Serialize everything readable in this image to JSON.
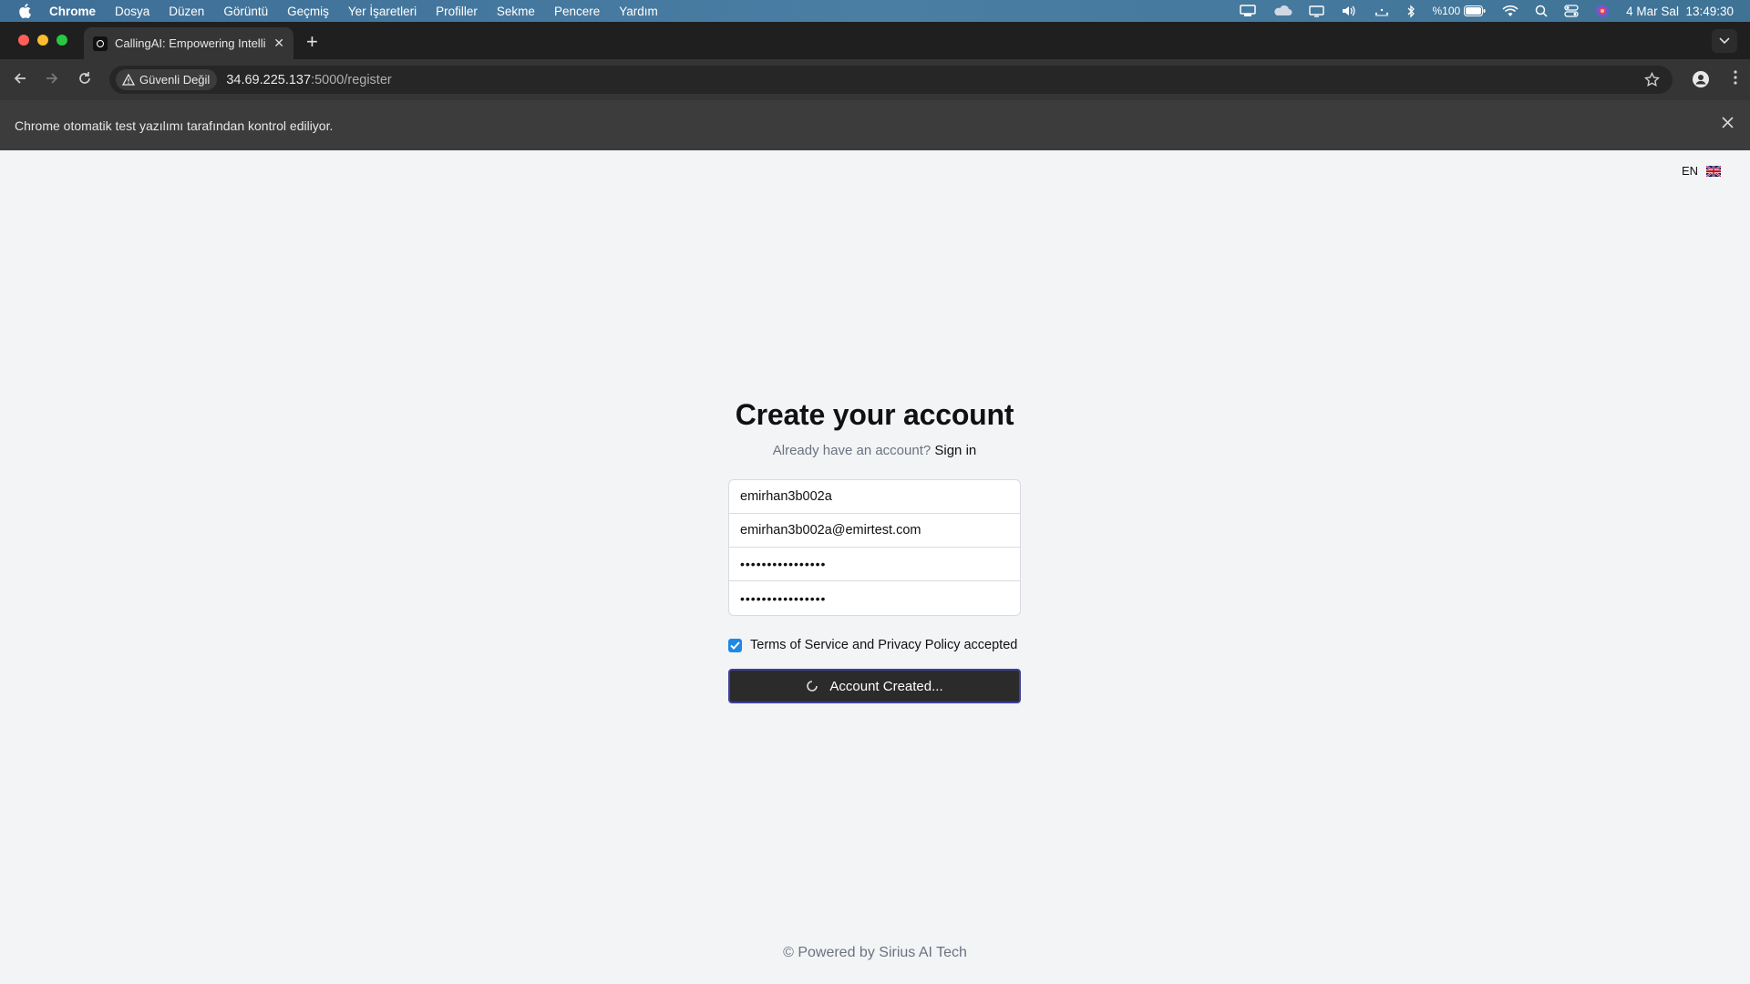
{
  "menubar": {
    "app": "Chrome",
    "items": [
      "Dosya",
      "Düzen",
      "Görüntü",
      "Geçmiş",
      "Yer İşaretleri",
      "Profiller",
      "Sekme",
      "Pencere",
      "Yardım"
    ],
    "battery": "%100",
    "datetime": "4 Mar Sal  13:49:30",
    "status_icons": [
      "screen-mirror-icon",
      "cloud-icon",
      "display-icon",
      "volume-icon",
      "dots-icon",
      "bluetooth-icon",
      "battery-icon",
      "wifi-icon",
      "search-icon",
      "control-center-icon",
      "siri-icon"
    ]
  },
  "browser": {
    "tab_title": "CallingAI: Empowering Intellig",
    "security_label": "Güvenli Değil",
    "url_host": "34.69.225.137",
    "url_path": ":5000/register",
    "infobar_text": "Chrome otomatik test yazılımı tarafından kontrol ediliyor."
  },
  "page": {
    "lang_code": "EN",
    "title": "Create your account",
    "subtitle_prefix": "Already have an account?",
    "signin_link": "Sign in",
    "fields": {
      "username": "emirhan3b002a",
      "email": "emirhan3b002a@emirtest.com",
      "password": "••••••••••••••••",
      "confirm_password": "••••••••••••••••"
    },
    "terms_label": "Terms of Service and Privacy Policy accepted",
    "terms_checked": true,
    "submit_label": "Account Created...",
    "footer": "© Powered by Sirius AI Tech"
  },
  "colors": {
    "menubar": "#4a7ea3",
    "accent_checkbox": "#1e88e5",
    "button_bg": "#2b2b2b",
    "button_border": "#3f3fa0"
  }
}
